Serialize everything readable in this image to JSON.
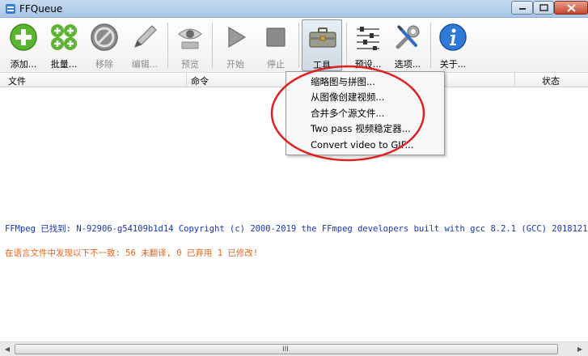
{
  "window": {
    "title": "FFQueue"
  },
  "toolbar": {
    "add": "添加...",
    "batch": "批量...",
    "remove": "移除",
    "edit": "编辑...",
    "preview": "预览",
    "start": "开始",
    "stop": "停止",
    "tools": "工具",
    "presets": "预设...",
    "options": "选项...",
    "about": "关于..."
  },
  "columns": {
    "file": "文件",
    "command": "命令",
    "status": "状态"
  },
  "menu": {
    "items": [
      "缩略图与拼图...",
      "从图像创建视频...",
      "合并多个源文件...",
      "Two pass 视频稳定器...",
      "Convert video to GIF..."
    ]
  },
  "log": {
    "line1": "FFMpeg 已找到: N-92906-g54109b1d14 Copyright (c) 2000-2019 the FFmpeg developers built with gcc 8.2.1 (GCC) 2018121",
    "line2": "在语言文件中发现以下不一致: 56 未翻译, 0 已弃用  1 已修改!"
  },
  "scrollbar": {
    "grip": "III"
  },
  "colors": {
    "log_info": "#1a35b4",
    "log_warning": "#e8641b",
    "annotation": "#e02020"
  }
}
